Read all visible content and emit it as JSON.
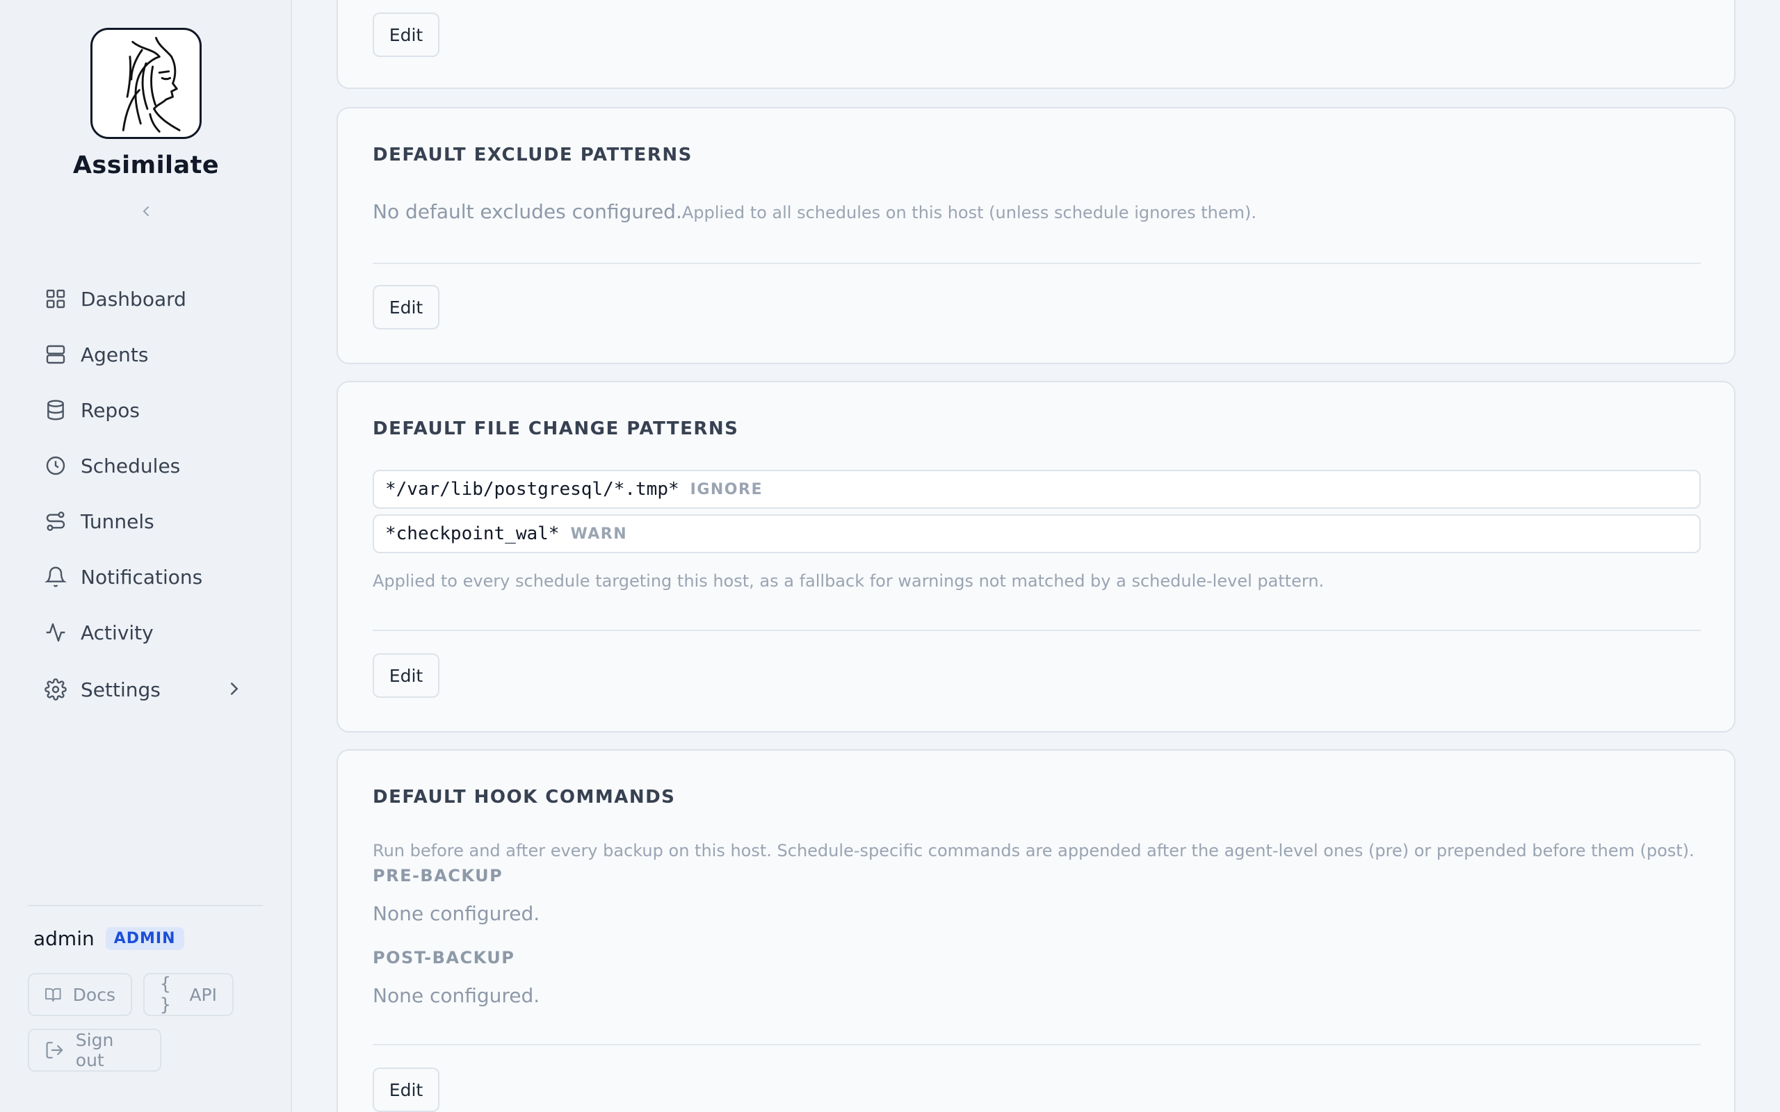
{
  "app": {
    "name": "Assimilate",
    "collapse_icon": "chevron-left-icon"
  },
  "sidebar": {
    "items": [
      {
        "label": "Dashboard",
        "icon": "grid-icon"
      },
      {
        "label": "Agents",
        "icon": "server-icon"
      },
      {
        "label": "Repos",
        "icon": "database-icon"
      },
      {
        "label": "Schedules",
        "icon": "clock-icon"
      },
      {
        "label": "Tunnels",
        "icon": "route-icon"
      },
      {
        "label": "Notifications",
        "icon": "bell-icon"
      },
      {
        "label": "Activity",
        "icon": "activity-icon"
      },
      {
        "label": "Settings",
        "icon": "gear-icon"
      }
    ],
    "user": {
      "name": "admin",
      "role": "ADMIN"
    },
    "docs_label": "Docs",
    "api_label": "API",
    "api_glyph": "{ }",
    "signout_label": "Sign out"
  },
  "main": {
    "top_card": {
      "edit_label": "Edit"
    },
    "exclude_card": {
      "title": "DEFAULT EXCLUDE PATTERNS",
      "empty_text": "No default excludes configured.",
      "help_text": "Applied to all schedules on this host (unless schedule ignores them).",
      "edit_label": "Edit"
    },
    "file_change_card": {
      "title": "DEFAULT FILE CHANGE PATTERNS",
      "patterns": [
        {
          "pattern": "*/var/lib/postgresql/*.tmp*",
          "action": "IGNORE"
        },
        {
          "pattern": "*checkpoint_wal*",
          "action": "WARN"
        }
      ],
      "help_text": "Applied to every schedule targeting this host, as a fallback for warnings not matched by a schedule-level pattern.",
      "edit_label": "Edit"
    },
    "hook_card": {
      "title": "DEFAULT HOOK COMMANDS",
      "help_text": "Run before and after every backup on this host. Schedule-specific commands are appended after the agent-level ones (pre) or prepended before them (post).",
      "pre_label": "PRE-BACKUP",
      "pre_value": "None configured.",
      "post_label": "POST-BACKUP",
      "post_value": "None configured.",
      "edit_label": "Edit"
    }
  },
  "colors": {
    "sidebar_bg": "#eef2f6",
    "page_bg": "#f1f4f8",
    "card_bg": "#f8fafc",
    "accent": "#1d4ed8",
    "muted_text": "#9aa4b2"
  }
}
